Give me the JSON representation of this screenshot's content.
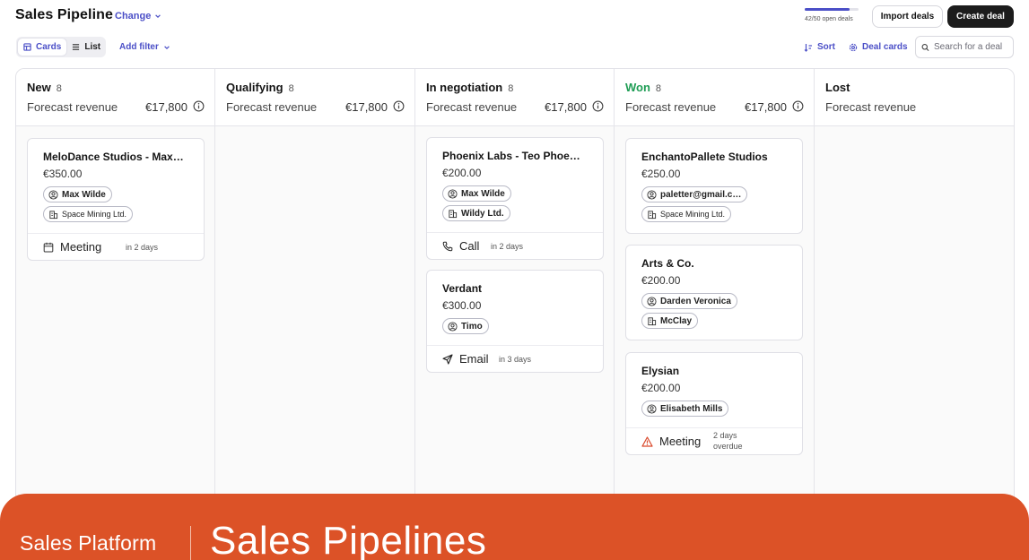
{
  "header": {
    "title": "Sales Pipeline",
    "change_label": "Change",
    "deals_meter": {
      "text": "42/50 open deals",
      "fraction": 0.84
    },
    "import_label": "Import deals",
    "create_label": "Create deal"
  },
  "toolbar": {
    "view_cards": "Cards",
    "view_list": "List",
    "add_filter": "Add filter",
    "sort": "Sort",
    "deal_cards": "Deal cards",
    "search_placeholder": "Search for a deal"
  },
  "columns": [
    {
      "name": "New",
      "count": "8",
      "forecast_label": "Forecast revenue",
      "forecast_value": "€17,800",
      "cards": [
        {
          "title": "MeloDance Studios - Max…",
          "amount": "€350.00",
          "contact": "Max Wilde",
          "company": "Space Mining Ltd.",
          "activity": "Meeting",
          "when": "in 2 days"
        }
      ]
    },
    {
      "name": "Qualifying",
      "count": "8",
      "forecast_label": "Forecast revenue",
      "forecast_value": "€17,800",
      "cards": []
    },
    {
      "name": "In negotiation",
      "count": "8",
      "forecast_label": "Forecast revenue",
      "forecast_value": "€17,800",
      "cards": [
        {
          "title": "Phoenix Labs - Teo Phoe…",
          "amount": "€200.00",
          "contact": "Max Wilde",
          "company": "Wildy Ltd.",
          "activity": "Call",
          "when": "in 2 days"
        },
        {
          "title": "Verdant",
          "amount": "€300.00",
          "contact": "Timo",
          "activity": "Email",
          "when": "in 3 days"
        }
      ]
    },
    {
      "name": "Won",
      "count": "8",
      "forecast_label": "Forecast revenue",
      "forecast_value": "€17,800",
      "cards": [
        {
          "title": "EnchantoPallete Studios",
          "amount": "€250.00",
          "contact": "paletter@gmail.c…",
          "company": "Space Mining Ltd."
        },
        {
          "title": "Arts & Co.",
          "amount": "€200.00",
          "contact": "Darden Veronica",
          "company": "McClay"
        },
        {
          "title": "Elysian",
          "amount": "€200.00",
          "contact": "Elisabeth Mills",
          "activity": "Meeting",
          "when_line1": "2 days",
          "when_line2": "overdue"
        }
      ]
    },
    {
      "name": "Lost",
      "forecast_label": "Forecast revenue",
      "cards": []
    }
  ],
  "banner": {
    "left": "Sales Platform",
    "right": "Sales Pipelines"
  },
  "colors": {
    "accent": "#4b4fc7",
    "won": "#1f9d55",
    "banner": "#dc5227",
    "overdue": "#d9482a"
  }
}
